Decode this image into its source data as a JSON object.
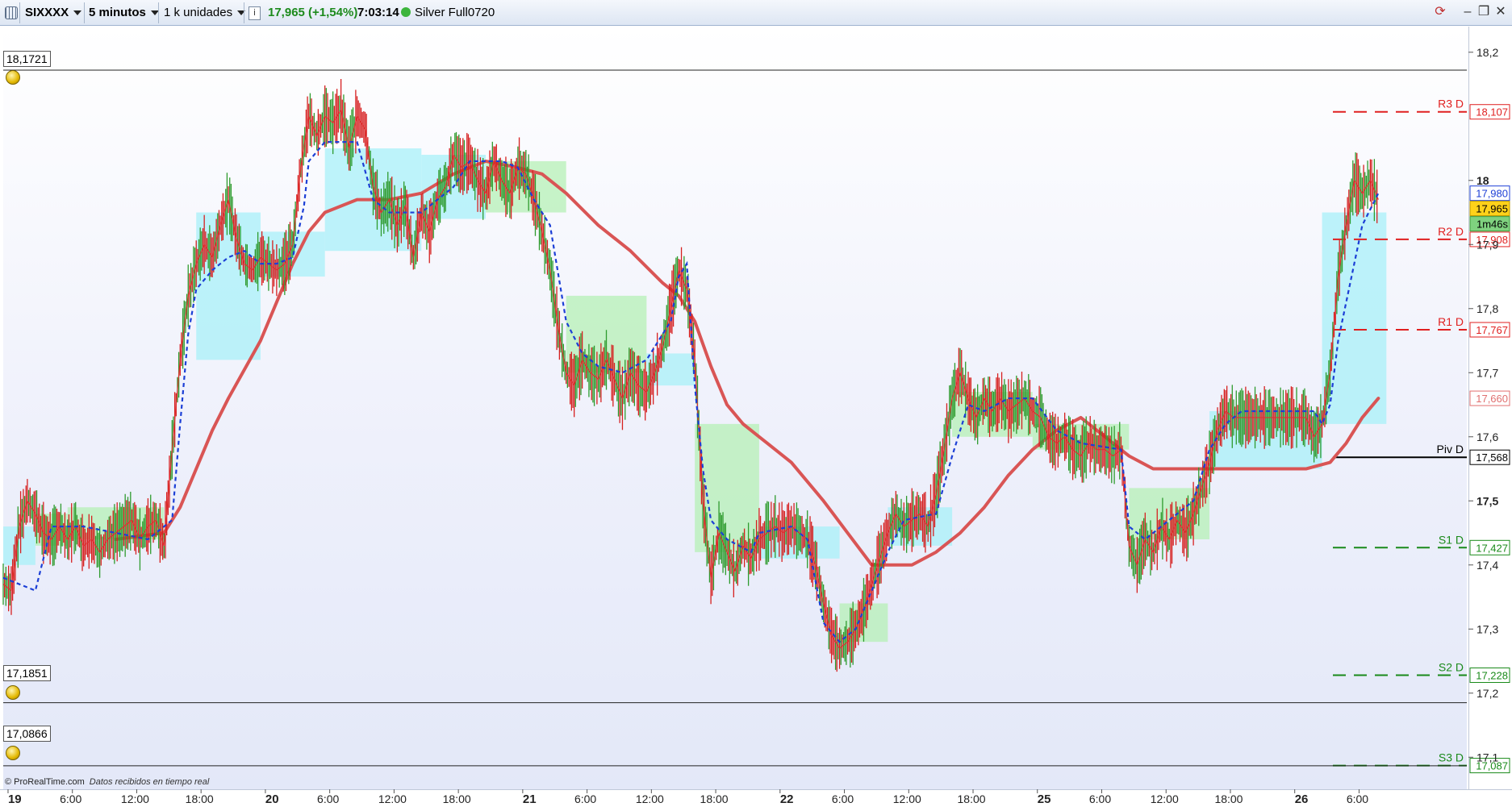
{
  "toolbar": {
    "symbol": "SIXXXX",
    "timeframe": "5 minutos",
    "units": "1 k unidades",
    "info": "i",
    "price_change": "17,965 (+1,54%)",
    "time": "7:03:14",
    "account": "Silver Full0720"
  },
  "footer": {
    "brand": "© ProRealTime.com",
    "status": "Datos recibidos en tiempo real"
  },
  "alert_lines": [
    {
      "label": "18,1721",
      "value": 18.1721
    },
    {
      "label": "17,1851",
      "value": 17.1851
    },
    {
      "label": "17,0866",
      "value": 17.0866
    }
  ],
  "price_tags": {
    "blue": "17,980",
    "current": "17,965",
    "countdown": "1m46s",
    "red_ma": "17,660"
  },
  "colors": {
    "candle_up": "#2e9b2e",
    "candle_down": "#d62020",
    "close_line": "#e03030",
    "kijun_dotted": "#1c3fd6",
    "moving_average": "#d95555",
    "cloud_bull": "#a8f0f8",
    "cloud_bear": "#b6f0b6",
    "resistance": "#e02020",
    "support": "#1a8a1a",
    "pivot": "#000000"
  },
  "chart_data": {
    "type": "line",
    "title": "",
    "series_note": "",
    "ylim": [
      17.05,
      18.24
    ],
    "y_ticks": [
      {
        "value": 18.2,
        "label": "18,2"
      },
      {
        "value": 18.0,
        "label": "18"
      },
      {
        "value": 17.9,
        "label": "17,9"
      },
      {
        "value": 17.8,
        "label": "17,8"
      },
      {
        "value": 17.7,
        "label": "17,7"
      },
      {
        "value": 17.6,
        "label": "17,6"
      },
      {
        "value": 17.5,
        "label": "17,5"
      },
      {
        "value": 17.4,
        "label": "17,4"
      },
      {
        "value": 17.3,
        "label": "17,3"
      },
      {
        "value": 17.2,
        "label": "17,2"
      },
      {
        "value": 17.1,
        "label": "17,1"
      }
    ],
    "x_ticks": [
      {
        "label": "19",
        "bold": true
      },
      {
        "label": "6:00",
        "bold": false
      },
      {
        "label": "12:00",
        "bold": false
      },
      {
        "label": "18:00",
        "bold": false
      },
      {
        "label": "20",
        "bold": true
      },
      {
        "label": "6:00",
        "bold": false
      },
      {
        "label": "12:00",
        "bold": false
      },
      {
        "label": "18:00",
        "bold": false
      },
      {
        "label": "21",
        "bold": true
      },
      {
        "label": "6:00",
        "bold": false
      },
      {
        "label": "12:00",
        "bold": false
      },
      {
        "label": "18:00",
        "bold": false
      },
      {
        "label": "22",
        "bold": true
      },
      {
        "label": "6:00",
        "bold": false
      },
      {
        "label": "12:00",
        "bold": false
      },
      {
        "label": "18:00",
        "bold": false
      },
      {
        "label": "25",
        "bold": true
      },
      {
        "label": "6:00",
        "bold": false
      },
      {
        "label": "12:00",
        "bold": false
      },
      {
        "label": "18:00",
        "bold": false
      },
      {
        "label": "26",
        "bold": true
      },
      {
        "label": "6:00",
        "bold": false
      }
    ],
    "pivot_levels": [
      {
        "name": "R3 D",
        "value": 18.107,
        "label": "18,107",
        "kind": "resistance"
      },
      {
        "name": "R2 D",
        "value": 17.908,
        "label": "17,908",
        "kind": "resistance"
      },
      {
        "name": "R1 D",
        "value": 17.767,
        "label": "17,767",
        "kind": "resistance"
      },
      {
        "name": "Piv D",
        "value": 17.568,
        "label": "17,568",
        "kind": "pivot"
      },
      {
        "name": "S1 D",
        "value": 17.427,
        "label": "17,427",
        "kind": "support"
      },
      {
        "name": "S2 D",
        "value": 17.228,
        "label": "17,228",
        "kind": "support"
      },
      {
        "name": "S3 D",
        "value": 17.087,
        "label": "17,087",
        "kind": "support"
      }
    ],
    "price_path": [
      [
        0,
        17.37
      ],
      [
        0.5,
        17.36
      ],
      [
        1,
        17.46
      ],
      [
        1.5,
        17.5
      ],
      [
        2,
        17.48
      ],
      [
        2.5,
        17.45
      ],
      [
        3,
        17.44
      ],
      [
        3.5,
        17.46
      ],
      [
        4,
        17.44
      ],
      [
        4.5,
        17.46
      ],
      [
        5,
        17.43
      ],
      [
        5.5,
        17.44
      ],
      [
        6,
        17.42
      ],
      [
        6.5,
        17.44
      ],
      [
        7,
        17.45
      ],
      [
        7.5,
        17.46
      ],
      [
        8,
        17.47
      ],
      [
        8.5,
        17.44
      ],
      [
        9,
        17.46
      ],
      [
        9.5,
        17.47
      ],
      [
        10,
        17.43
      ],
      [
        10.5,
        17.58
      ],
      [
        11,
        17.72
      ],
      [
        11.5,
        17.82
      ],
      [
        12,
        17.87
      ],
      [
        12.5,
        17.9
      ],
      [
        13,
        17.88
      ],
      [
        13.5,
        17.93
      ],
      [
        14,
        17.97
      ],
      [
        14.5,
        17.91
      ],
      [
        15,
        17.87
      ],
      [
        15.5,
        17.86
      ],
      [
        16,
        17.88
      ],
      [
        16.5,
        17.87
      ],
      [
        17,
        17.86
      ],
      [
        17.5,
        17.87
      ],
      [
        18,
        17.9
      ],
      [
        18.5,
        18.02
      ],
      [
        19,
        18.1
      ],
      [
        19.5,
        18.07
      ],
      [
        20,
        18.1
      ],
      [
        20.5,
        18.09
      ],
      [
        21,
        18.11
      ],
      [
        21.5,
        18.05
      ],
      [
        22,
        18.1
      ],
      [
        22.5,
        18.08
      ],
      [
        23,
        17.99
      ],
      [
        23.5,
        17.95
      ],
      [
        24,
        17.97
      ],
      [
        24.5,
        17.93
      ],
      [
        25,
        17.96
      ],
      [
        25.5,
        17.88
      ],
      [
        26,
        17.95
      ],
      [
        26.5,
        17.92
      ],
      [
        27,
        17.97
      ],
      [
        27.5,
        17.99
      ],
      [
        28,
        18.04
      ],
      [
        28.5,
        18.02
      ],
      [
        29,
        18.03
      ],
      [
        29.5,
        18.0
      ],
      [
        30,
        17.98
      ],
      [
        30.5,
        18.03
      ],
      [
        31,
        18.0
      ],
      [
        31.5,
        17.98
      ],
      [
        32,
        18.02
      ],
      [
        32.5,
        18.01
      ],
      [
        33,
        17.97
      ],
      [
        33.5,
        17.92
      ],
      [
        34,
        17.86
      ],
      [
        34.5,
        17.77
      ],
      [
        35,
        17.7
      ],
      [
        35.5,
        17.68
      ],
      [
        36,
        17.72
      ],
      [
        36.5,
        17.7
      ],
      [
        37,
        17.69
      ],
      [
        37.5,
        17.72
      ],
      [
        38,
        17.69
      ],
      [
        38.5,
        17.66
      ],
      [
        39,
        17.7
      ],
      [
        39.5,
        17.68
      ],
      [
        40,
        17.67
      ],
      [
        40.5,
        17.7
      ],
      [
        41,
        17.74
      ],
      [
        41.5,
        17.8
      ],
      [
        42,
        17.86
      ],
      [
        42.5,
        17.83
      ],
      [
        43,
        17.72
      ],
      [
        43.5,
        17.5
      ],
      [
        44,
        17.38
      ],
      [
        44.5,
        17.45
      ],
      [
        45,
        17.42
      ],
      [
        45.5,
        17.39
      ],
      [
        46,
        17.43
      ],
      [
        46.5,
        17.41
      ],
      [
        47,
        17.44
      ],
      [
        47.5,
        17.45
      ],
      [
        48,
        17.46
      ],
      [
        48.5,
        17.45
      ],
      [
        49,
        17.46
      ],
      [
        49.5,
        17.45
      ],
      [
        50,
        17.44
      ],
      [
        50.5,
        17.4
      ],
      [
        51,
        17.34
      ],
      [
        51.5,
        17.29
      ],
      [
        52,
        17.27
      ],
      [
        52.5,
        17.28
      ],
      [
        53,
        17.3
      ],
      [
        53.5,
        17.33
      ],
      [
        54,
        17.37
      ],
      [
        54.5,
        17.41
      ],
      [
        55,
        17.45
      ],
      [
        55.5,
        17.48
      ],
      [
        56,
        17.46
      ],
      [
        56.5,
        17.47
      ],
      [
        57,
        17.48
      ],
      [
        57.5,
        17.46
      ],
      [
        58,
        17.51
      ],
      [
        58.5,
        17.58
      ],
      [
        59,
        17.66
      ],
      [
        59.5,
        17.7
      ],
      [
        60,
        17.66
      ],
      [
        60.5,
        17.63
      ],
      [
        61,
        17.66
      ],
      [
        61.5,
        17.64
      ],
      [
        62,
        17.66
      ],
      [
        62.5,
        17.64
      ],
      [
        63,
        17.65
      ],
      [
        63.5,
        17.66
      ],
      [
        64,
        17.64
      ],
      [
        64.5,
        17.63
      ],
      [
        65,
        17.6
      ],
      [
        65.5,
        17.59
      ],
      [
        66,
        17.6
      ],
      [
        66.5,
        17.58
      ],
      [
        67,
        17.57
      ],
      [
        67.5,
        17.59
      ],
      [
        68,
        17.58
      ],
      [
        68.5,
        17.58
      ],
      [
        69,
        17.57
      ],
      [
        69.5,
        17.58
      ],
      [
        70,
        17.43
      ],
      [
        70.5,
        17.4
      ],
      [
        71,
        17.44
      ],
      [
        71.5,
        17.42
      ],
      [
        72,
        17.46
      ],
      [
        72.5,
        17.44
      ],
      [
        73,
        17.47
      ],
      [
        73.5,
        17.45
      ],
      [
        74,
        17.48
      ],
      [
        74.5,
        17.52
      ],
      [
        75,
        17.56
      ],
      [
        75.5,
        17.61
      ],
      [
        76,
        17.64
      ],
      [
        76.5,
        17.63
      ],
      [
        77,
        17.63
      ],
      [
        77.5,
        17.63
      ],
      [
        78,
        17.63
      ],
      [
        78.5,
        17.63
      ],
      [
        79,
        17.63
      ],
      [
        79.5,
        17.63
      ],
      [
        80,
        17.63
      ],
      [
        80.5,
        17.63
      ],
      [
        81,
        17.63
      ],
      [
        81.5,
        17.6
      ],
      [
        82,
        17.62
      ],
      [
        82.5,
        17.7
      ],
      [
        83,
        17.85
      ],
      [
        83.5,
        17.93
      ],
      [
        84,
        18.0
      ],
      [
        84.5,
        17.98
      ],
      [
        85,
        18.0
      ],
      [
        85.5,
        17.97
      ]
    ],
    "kijun_path": [
      [
        0,
        17.38
      ],
      [
        2,
        17.36
      ],
      [
        3,
        17.46
      ],
      [
        5,
        17.46
      ],
      [
        7,
        17.45
      ],
      [
        9,
        17.44
      ],
      [
        10.5,
        17.47
      ],
      [
        11,
        17.62
      ],
      [
        11.5,
        17.76
      ],
      [
        12,
        17.83
      ],
      [
        13,
        17.86
      ],
      [
        14,
        17.88
      ],
      [
        15,
        17.89
      ],
      [
        16,
        17.87
      ],
      [
        17,
        17.87
      ],
      [
        18,
        17.88
      ],
      [
        18.7,
        17.96
      ],
      [
        19,
        18.03
      ],
      [
        20,
        18.06
      ],
      [
        22,
        18.06
      ],
      [
        23,
        17.97
      ],
      [
        24,
        17.95
      ],
      [
        26,
        17.95
      ],
      [
        28,
        17.99
      ],
      [
        29,
        18.03
      ],
      [
        31,
        18.03
      ],
      [
        32,
        18.02
      ],
      [
        33,
        17.97
      ],
      [
        34,
        17.93
      ],
      [
        35,
        17.78
      ],
      [
        36,
        17.73
      ],
      [
        37,
        17.71
      ],
      [
        38.5,
        17.7
      ],
      [
        40,
        17.72
      ],
      [
        41.5,
        17.78
      ],
      [
        42,
        17.85
      ],
      [
        42.5,
        17.87
      ],
      [
        43,
        17.68
      ],
      [
        43.5,
        17.55
      ],
      [
        44,
        17.47
      ],
      [
        45,
        17.44
      ],
      [
        46.5,
        17.42
      ],
      [
        47,
        17.45
      ],
      [
        49,
        17.46
      ],
      [
        50,
        17.44
      ],
      [
        51,
        17.31
      ],
      [
        52,
        17.28
      ],
      [
        53,
        17.3
      ],
      [
        54,
        17.36
      ],
      [
        55,
        17.42
      ],
      [
        56,
        17.47
      ],
      [
        58,
        17.48
      ],
      [
        59,
        17.57
      ],
      [
        60,
        17.65
      ],
      [
        61,
        17.64
      ],
      [
        62.5,
        17.66
      ],
      [
        64,
        17.66
      ],
      [
        65.5,
        17.61
      ],
      [
        67,
        17.59
      ],
      [
        69.5,
        17.58
      ],
      [
        70,
        17.46
      ],
      [
        71,
        17.44
      ],
      [
        72.5,
        17.47
      ],
      [
        74,
        17.5
      ],
      [
        75,
        17.58
      ],
      [
        76,
        17.62
      ],
      [
        77,
        17.64
      ],
      [
        79,
        17.64
      ],
      [
        81.5,
        17.64
      ],
      [
        82,
        17.62
      ],
      [
        82.5,
        17.65
      ],
      [
        83,
        17.75
      ],
      [
        84,
        17.87
      ],
      [
        84.5,
        17.93
      ],
      [
        85.5,
        17.98
      ]
    ],
    "moving_average_path": [
      [
        7,
        17.44
      ],
      [
        10,
        17.45
      ],
      [
        11,
        17.49
      ],
      [
        12,
        17.55
      ],
      [
        13,
        17.61
      ],
      [
        14,
        17.66
      ],
      [
        16,
        17.75
      ],
      [
        17,
        17.81
      ],
      [
        18,
        17.87
      ],
      [
        19,
        17.92
      ],
      [
        20,
        17.95
      ],
      [
        22,
        17.97
      ],
      [
        24,
        17.97
      ],
      [
        26,
        17.98
      ],
      [
        28,
        18.01
      ],
      [
        30,
        18.03
      ],
      [
        32,
        18.02
      ],
      [
        33.5,
        18.01
      ],
      [
        35,
        17.98
      ],
      [
        37,
        17.93
      ],
      [
        39,
        17.89
      ],
      [
        41,
        17.84
      ],
      [
        42,
        17.82
      ],
      [
        43,
        17.78
      ],
      [
        44,
        17.71
      ],
      [
        45,
        17.65
      ],
      [
        46,
        17.62
      ],
      [
        47,
        17.6
      ],
      [
        47.5,
        17.59
      ],
      [
        49,
        17.56
      ],
      [
        51,
        17.5
      ],
      [
        52.5,
        17.45
      ],
      [
        54,
        17.4
      ],
      [
        55,
        17.4
      ],
      [
        56.5,
        17.4
      ],
      [
        58,
        17.42
      ],
      [
        59.5,
        17.45
      ],
      [
        61,
        17.49
      ],
      [
        62.5,
        17.54
      ],
      [
        64,
        17.58
      ],
      [
        65.5,
        17.61
      ],
      [
        67,
        17.63
      ],
      [
        68,
        17.61
      ],
      [
        69,
        17.59
      ],
      [
        70,
        17.57
      ],
      [
        71.5,
        17.55
      ],
      [
        73,
        17.55
      ],
      [
        75,
        17.55
      ],
      [
        77,
        17.55
      ],
      [
        79,
        17.55
      ],
      [
        81,
        17.55
      ],
      [
        82.5,
        17.56
      ],
      [
        83.5,
        17.59
      ],
      [
        84.5,
        17.63
      ],
      [
        85.5,
        17.66
      ]
    ],
    "cloud_segments": [
      {
        "x0": 0,
        "x1": 2,
        "lo": 17.4,
        "hi": 17.46,
        "kind": "bull"
      },
      {
        "x0": 2,
        "x1": 4,
        "lo": 17.43,
        "hi": 17.48,
        "kind": "bear"
      },
      {
        "x0": 4,
        "x1": 10,
        "lo": 17.44,
        "hi": 17.49,
        "kind": "bear"
      },
      {
        "x0": 12,
        "x1": 16,
        "lo": 17.72,
        "hi": 17.95,
        "kind": "bull"
      },
      {
        "x0": 16,
        "x1": 20,
        "lo": 17.85,
        "hi": 17.92,
        "kind": "bull"
      },
      {
        "x0": 20,
        "x1": 26,
        "lo": 17.89,
        "hi": 18.05,
        "kind": "bull"
      },
      {
        "x0": 26,
        "x1": 30,
        "lo": 17.94,
        "hi": 18.04,
        "kind": "bull"
      },
      {
        "x0": 30,
        "x1": 35,
        "lo": 17.95,
        "hi": 18.03,
        "kind": "bear"
      },
      {
        "x0": 35,
        "x1": 40,
        "lo": 17.7,
        "hi": 17.82,
        "kind": "bear"
      },
      {
        "x0": 40,
        "x1": 43,
        "lo": 17.68,
        "hi": 17.73,
        "kind": "bull"
      },
      {
        "x0": 43,
        "x1": 47,
        "lo": 17.42,
        "hi": 17.62,
        "kind": "bear"
      },
      {
        "x0": 47,
        "x1": 52,
        "lo": 17.41,
        "hi": 17.46,
        "kind": "bull"
      },
      {
        "x0": 52,
        "x1": 55,
        "lo": 17.28,
        "hi": 17.34,
        "kind": "bear"
      },
      {
        "x0": 55,
        "x1": 59,
        "lo": 17.43,
        "hi": 17.49,
        "kind": "bull"
      },
      {
        "x0": 59,
        "x1": 64,
        "lo": 17.6,
        "hi": 17.67,
        "kind": "bear"
      },
      {
        "x0": 64,
        "x1": 70,
        "lo": 17.58,
        "hi": 17.62,
        "kind": "bear"
      },
      {
        "x0": 70,
        "x1": 75,
        "lo": 17.44,
        "hi": 17.52,
        "kind": "bear"
      },
      {
        "x0": 75,
        "x1": 82,
        "lo": 17.55,
        "hi": 17.64,
        "kind": "bull"
      },
      {
        "x0": 82,
        "x1": 86,
        "lo": 17.62,
        "hi": 17.95,
        "kind": "bull"
      }
    ]
  }
}
